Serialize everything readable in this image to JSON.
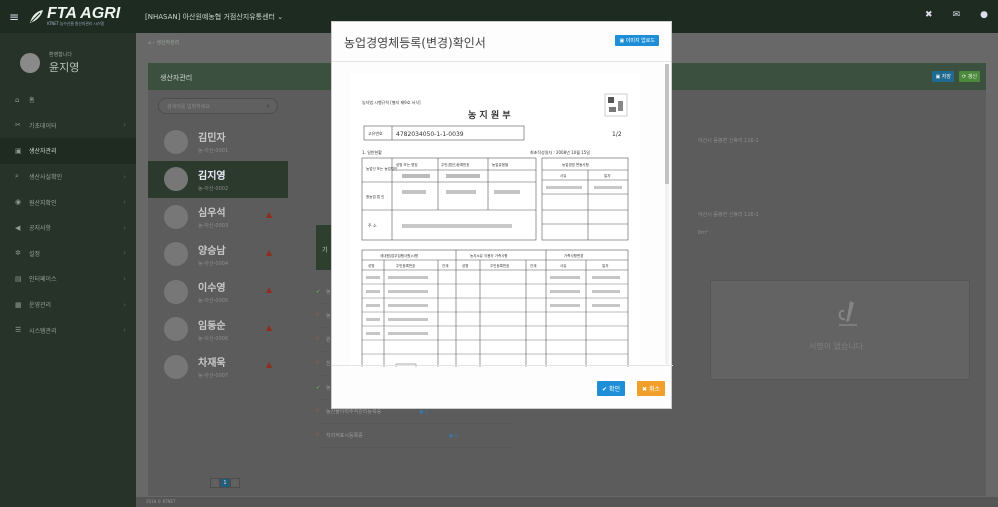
{
  "header": {
    "logo_text": "FTA AGRI",
    "logo_sub": "KTNET 농수산물 원산지관리 시스템",
    "org": "[NHASAN] 아산원예농협 거점산지유통센터",
    "org_caret": "⌄"
  },
  "sidebar": {
    "welcome": "환영합니다",
    "user_name": "윤지영",
    "items": [
      {
        "label": "홈",
        "icon": "home-icon"
      },
      {
        "label": "기초데이터",
        "icon": "tools-icon"
      },
      {
        "label": "생산자관리",
        "icon": "id-card-icon"
      },
      {
        "label": "생산사실확인",
        "icon": "search-icon"
      },
      {
        "label": "원산지확인",
        "icon": "globe-icon"
      },
      {
        "label": "공지사항",
        "icon": "megaphone-icon"
      },
      {
        "label": "설정",
        "icon": "gear-icon"
      },
      {
        "label": "인터페이스",
        "icon": "database-icon"
      },
      {
        "label": "운영관리",
        "icon": "grid-icon"
      },
      {
        "label": "시스템관리",
        "icon": "sliders-icon"
      }
    ]
  },
  "breadcrumb": "생산자관리",
  "panel": {
    "title": "생산자관리",
    "save_label": "저장",
    "refresh_label": "갱신",
    "search_placeholder": "검색어를 입력하세요"
  },
  "producers": [
    {
      "name": "김민자",
      "code": "농-아산-0001",
      "warn": false
    },
    {
      "name": "김지영",
      "code": "농-아산-0002",
      "warn": false
    },
    {
      "name": "심우석",
      "code": "농-아산-0003",
      "warn": true
    },
    {
      "name": "양승남",
      "code": "농-아산-0004",
      "warn": true
    },
    {
      "name": "이수영",
      "code": "농-아산-0005",
      "warn": true
    },
    {
      "name": "임동순",
      "code": "농-아산-0006",
      "warn": true
    },
    {
      "name": "차재욱",
      "code": "농-아산-0007",
      "warn": true
    }
  ],
  "pager": {
    "prev": "‹",
    "current": "1",
    "next": "›"
  },
  "detail": {
    "address1": "아산시 음봉면 신휴리 116-1",
    "address2": "아산시 음봉면 신휴리 116-1",
    "area_unit": "0m²",
    "stripe_label": "기",
    "docs": [
      {
        "mark": "✔",
        "label": "농",
        "ok": true
      },
      {
        "mark": "?",
        "label": "농",
        "ok": false
      },
      {
        "mark": "?",
        "label": "원",
        "ok": false
      },
      {
        "mark": "?",
        "label": "친",
        "ok": false
      },
      {
        "mark": "✔",
        "label": "농산",
        "ok": true
      },
      {
        "mark": "?",
        "label": "농산물이력추적관리등록증",
        "ok": false
      },
      {
        "mark": "?",
        "label": "지리적표시등록증",
        "ok": false
      }
    ],
    "sign_text": "서명이 없습니다"
  },
  "footer": "2018 © KTNET",
  "modal": {
    "title": "농업경영체등록(변경)확인서",
    "upload_label": "이미지 업로드",
    "ok_label": "✔ 확인",
    "cancel_label": "✖ 취소",
    "doc": {
      "law_ref": "농자법 시행규칙 [별지 제9호 서식]",
      "title": "농 지 원 부",
      "reg_no_label": "고유번호",
      "reg_no": "4782034050-1-1-0039",
      "page": "1/2",
      "section1": "1. 일반현황",
      "issued": "최초작성일자 : 2008년 10월 15일",
      "owner_label": "농업인 또는 농업법인",
      "col_name": "성명 또는 명칭",
      "col_rrn": "주민(법인)등록번호",
      "col_type": "농업유형별",
      "change_hist": "농업경영 변동사항",
      "col_reason": "사유",
      "col_date": "일자",
      "corp_label": "종농업 법 인",
      "addr_label": "주 소",
      "farm_family": "세대원(업무집행사원)사항",
      "owner_change": "농지소유 이용자 가족사항",
      "family_change": "가족사항변경",
      "c_name": "성명",
      "c_rrn": "주민등록번호",
      "c_rel": "관계",
      "stamp_text": "경기"
    }
  }
}
